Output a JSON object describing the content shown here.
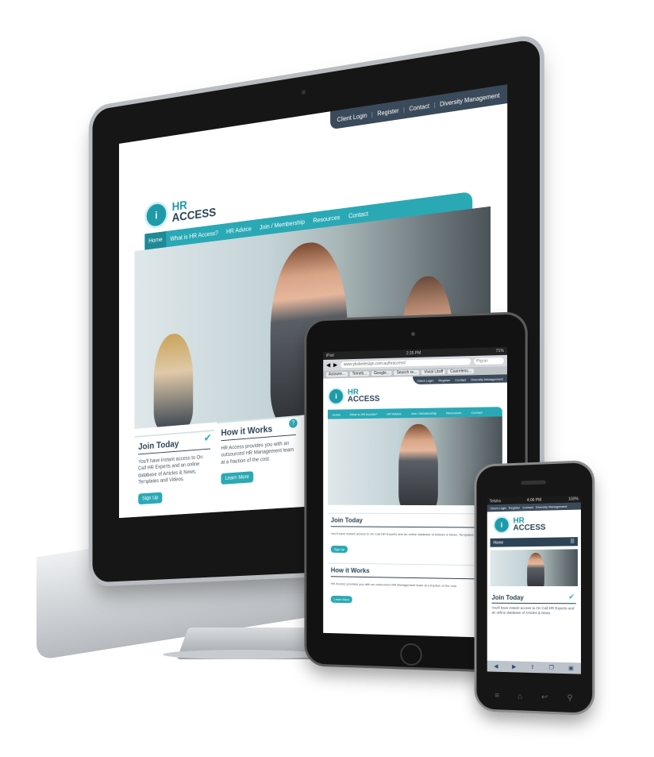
{
  "site": {
    "topbar_links": [
      "Client Login",
      "Register",
      "Contact",
      "Diversity Management"
    ],
    "logo_hr": "HR",
    "logo_access": "ACCESS",
    "nav": [
      "Home",
      "What is HR Access?",
      "HR Advice",
      "Join / Membership",
      "Resources",
      "Contact"
    ],
    "join_card": {
      "title": "Join Today",
      "text": "You'll have instant access to On Call HR Experts and an online database of Articles & News, Templates and Videos.",
      "button": "Sign Up"
    },
    "how_card": {
      "title": "How it Works",
      "text": "HR Access provides you with an outsourced HR Management team at a fraction of the cost.",
      "button": "Learn More"
    }
  },
  "tablet": {
    "status_left": "iPad",
    "status_time": "2:25 PM",
    "status_right": "71%",
    "url": "www.yksbedesign.com.au/hraccess/",
    "search_placeholder": "Pigran",
    "bookmarks": [
      "Asiowre...",
      "Temeb...",
      "Google...",
      "Search re...",
      "Vivial Litoff",
      "Casrelens..."
    ],
    "join_text": "You'll have instant access to On Call HR Experts and an online database of Articles & News, Templates and Videos.",
    "how_text": "HR Access provides you with an outsourced HR Management team at a fraction of the cost."
  },
  "phone": {
    "status_left": "Telstra",
    "status_time": "4:06 PM",
    "status_right": "100%",
    "menu_label": "Home",
    "join_text": "You'll have instant access to On Call HR Experts and an online database of Articles & News."
  }
}
